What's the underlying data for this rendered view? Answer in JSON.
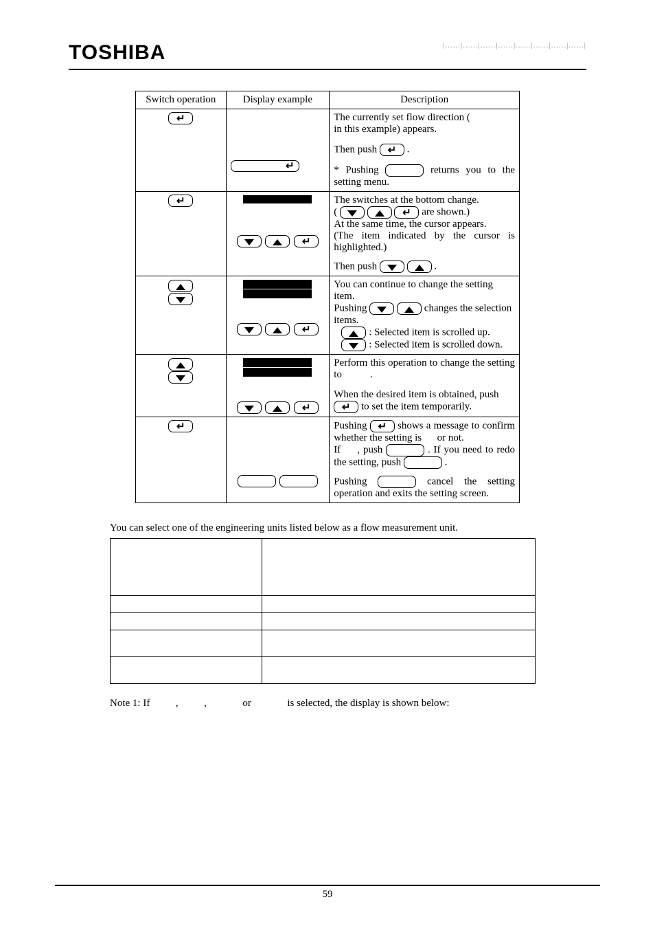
{
  "brand": "TOSHIBA",
  "header_dashes": "|......|......|......|......|......|......|......|......|",
  "table1": {
    "headers": [
      "Switch operation",
      "Display example",
      "Description"
    ],
    "rows": [
      {
        "desc_a": "The currently set flow direction (",
        "desc_b": "in this example) appears.",
        "desc_c": "Then push",
        "desc_d": ".",
        "desc_e": "* Pushing",
        "desc_f": "returns you to the setting menu."
      },
      {
        "desc_a": "The switches at the bottom change.",
        "desc_b": "(",
        "desc_c": "are shown.)",
        "desc_d": "At the same time, the cursor appears.",
        "desc_e": "(The item indicated by the cursor is highlighted.)",
        "desc_f": "Then push",
        "desc_g": "."
      },
      {
        "desc_a": "You can continue to change the setting item.",
        "desc_b": "Pushing",
        "desc_c": "changes the selection items.",
        "desc_d": ": Selected item is scrolled up.",
        "desc_e": ": Selected item is scrolled down."
      },
      {
        "desc_a": "Perform this operation to change the setting to",
        "desc_b": ".",
        "desc_c": "When the desired item is obtained, push",
        "desc_d": "to set the item temporarily."
      },
      {
        "desc_a": "Pushing",
        "desc_b": "shows a message to confirm whether the setting is",
        "desc_c": "or not.",
        "desc_d": "If",
        "desc_e": ", push",
        "desc_f": ". If you need to redo the setting, push",
        "desc_g": ".",
        "desc_h": "Pushing",
        "desc_i": "cancel the setting operation and exits the setting screen."
      }
    ]
  },
  "paragraph": "You can select one of the engineering units listed below as a flow measurement unit.",
  "note": {
    "a": "Note 1: If",
    "b": ",",
    "c": ",",
    "d": "or",
    "e": "is selected, the display is shown below:"
  },
  "pagenum": "59",
  "icons": {
    "enter": "↵"
  }
}
